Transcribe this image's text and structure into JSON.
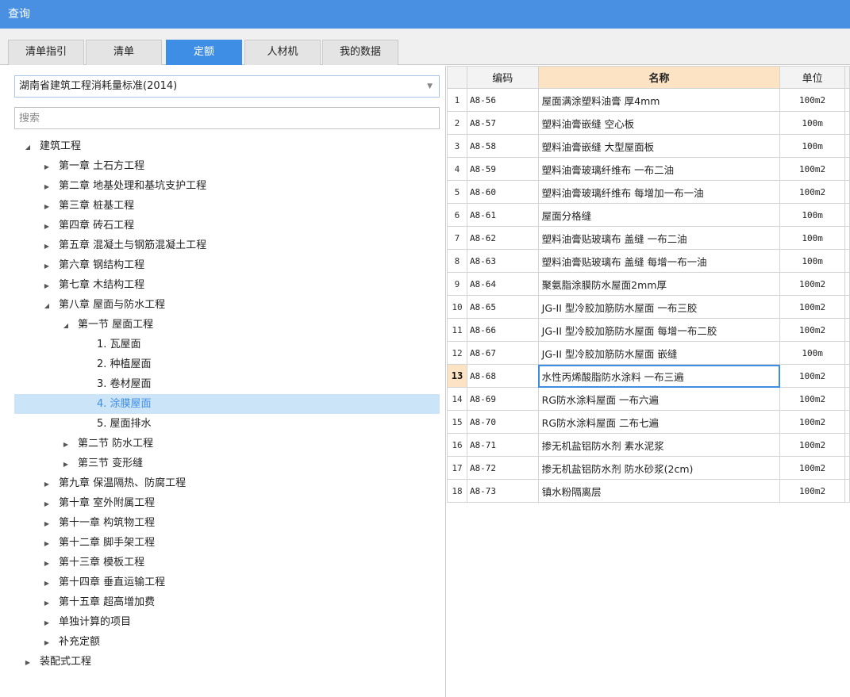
{
  "window": {
    "title": "查询"
  },
  "tabs": [
    {
      "label": "清单指引"
    },
    {
      "label": "清单"
    },
    {
      "label": "定额"
    },
    {
      "label": "人材机"
    },
    {
      "label": "我的数据"
    }
  ],
  "active_tab": "定额",
  "left": {
    "standard_select": {
      "value": "湖南省建筑工程消耗量标准(2014)"
    },
    "search": {
      "placeholder": "搜索"
    },
    "tree": [
      {
        "label": "建筑工程",
        "level": 0,
        "toggle": "expanded"
      },
      {
        "label": "第一章 土石方工程",
        "level": 1,
        "toggle": "collapsed"
      },
      {
        "label": "第二章 地基处理和基坑支护工程",
        "level": 1,
        "toggle": "collapsed"
      },
      {
        "label": "第三章 桩基工程",
        "level": 1,
        "toggle": "collapsed"
      },
      {
        "label": "第四章 砖石工程",
        "level": 1,
        "toggle": "collapsed"
      },
      {
        "label": "第五章 混凝土与钢筋混凝土工程",
        "level": 1,
        "toggle": "collapsed"
      },
      {
        "label": "第六章 钢结构工程",
        "level": 1,
        "toggle": "collapsed"
      },
      {
        "label": "第七章 木结构工程",
        "level": 1,
        "toggle": "collapsed"
      },
      {
        "label": "第八章 屋面与防水工程",
        "level": 1,
        "toggle": "expanded"
      },
      {
        "label": "第一节 屋面工程",
        "level": 2,
        "toggle": "expanded"
      },
      {
        "label": "1. 瓦屋面",
        "level": 3,
        "toggle": "none"
      },
      {
        "label": "2. 种植屋面",
        "level": 3,
        "toggle": "none"
      },
      {
        "label": "3. 卷材屋面",
        "level": 3,
        "toggle": "none"
      },
      {
        "label": "4. 涂膜屋面",
        "level": 3,
        "toggle": "none",
        "selected": true
      },
      {
        "label": "5. 屋面排水",
        "level": 3,
        "toggle": "none"
      },
      {
        "label": "第二节 防水工程",
        "level": 2,
        "toggle": "collapsed"
      },
      {
        "label": "第三节 变形缝",
        "level": 2,
        "toggle": "collapsed"
      },
      {
        "label": "第九章 保温隔热、防腐工程",
        "level": 1,
        "toggle": "collapsed"
      },
      {
        "label": "第十章 室外附属工程",
        "level": 1,
        "toggle": "collapsed"
      },
      {
        "label": "第十一章 构筑物工程",
        "level": 1,
        "toggle": "collapsed"
      },
      {
        "label": "第十二章 脚手架工程",
        "level": 1,
        "toggle": "collapsed"
      },
      {
        "label": "第十三章 模板工程",
        "level": 1,
        "toggle": "collapsed"
      },
      {
        "label": "第十四章 垂直运输工程",
        "level": 1,
        "toggle": "collapsed"
      },
      {
        "label": "第十五章 超高增加费",
        "level": 1,
        "toggle": "collapsed"
      },
      {
        "label": "单独计算的项目",
        "level": 1,
        "toggle": "collapsed"
      },
      {
        "label": "补充定额",
        "level": 1,
        "toggle": "collapsed"
      },
      {
        "label": "装配式工程",
        "level": 0,
        "toggle": "collapsed"
      }
    ]
  },
  "grid": {
    "columns": {
      "code": "编码",
      "name": "名称",
      "unit": "单位"
    },
    "current_row": 13,
    "rows": [
      {
        "num": "1",
        "code": "A8-56",
        "name": "屋面满涂塑料油膏 厚4mm",
        "unit": "100m2"
      },
      {
        "num": "2",
        "code": "A8-57",
        "name": "塑料油膏嵌缝 空心板",
        "unit": "100m"
      },
      {
        "num": "3",
        "code": "A8-58",
        "name": "塑料油膏嵌缝 大型屋面板",
        "unit": "100m"
      },
      {
        "num": "4",
        "code": "A8-59",
        "name": "塑料油膏玻璃纤维布 一布二油",
        "unit": "100m2"
      },
      {
        "num": "5",
        "code": "A8-60",
        "name": "塑料油膏玻璃纤维布 每增加一布一油",
        "unit": "100m2"
      },
      {
        "num": "6",
        "code": "A8-61",
        "name": "屋面分格缝",
        "unit": "100m"
      },
      {
        "num": "7",
        "code": "A8-62",
        "name": "塑料油膏贴玻璃布 盖缝 一布二油",
        "unit": "100m"
      },
      {
        "num": "8",
        "code": "A8-63",
        "name": "塑料油膏贴玻璃布 盖缝 每增一布一油",
        "unit": "100m"
      },
      {
        "num": "9",
        "code": "A8-64",
        "name": "聚氨脂涂膜防水屋面2mm厚",
        "unit": "100m2"
      },
      {
        "num": "10",
        "code": "A8-65",
        "name": "JG-II 型冷胶加筋防水屋面 一布三胶",
        "unit": "100m2"
      },
      {
        "num": "11",
        "code": "A8-66",
        "name": "JG-II 型冷胶加筋防水屋面 每增一布二胶",
        "unit": "100m2"
      },
      {
        "num": "12",
        "code": "A8-67",
        "name": "JG-II 型冷胶加筋防水屋面 嵌缝",
        "unit": "100m"
      },
      {
        "num": "13",
        "code": "A8-68",
        "name": "水性丙烯酸脂防水涂料 一布三遍",
        "unit": "100m2"
      },
      {
        "num": "14",
        "code": "A8-69",
        "name": "RG防水涂料屋面 一布六遍",
        "unit": "100m2"
      },
      {
        "num": "15",
        "code": "A8-70",
        "name": "RG防水涂料屋面 二布七遍",
        "unit": "100m2"
      },
      {
        "num": "16",
        "code": "A8-71",
        "name": "掺无机盐铝防水剂 素水泥浆",
        "unit": "100m2"
      },
      {
        "num": "17",
        "code": "A8-72",
        "name": "掺无机盐铝防水剂 防水砂浆(2cm)",
        "unit": "100m2"
      },
      {
        "num": "18",
        "code": "A8-73",
        "name": "镇水粉隔离层",
        "unit": "100m2"
      }
    ]
  },
  "colors": {
    "titlebar": "#4a90e2",
    "active_tab": "#3f8ee6",
    "selected_node_bg": "#cce4f7",
    "sorted_header": "#fbe3c4"
  },
  "icons": {
    "expanded": "triangle-down-icon",
    "collapsed": "triangle-right-icon",
    "dropdown": "chevron-down-icon"
  }
}
